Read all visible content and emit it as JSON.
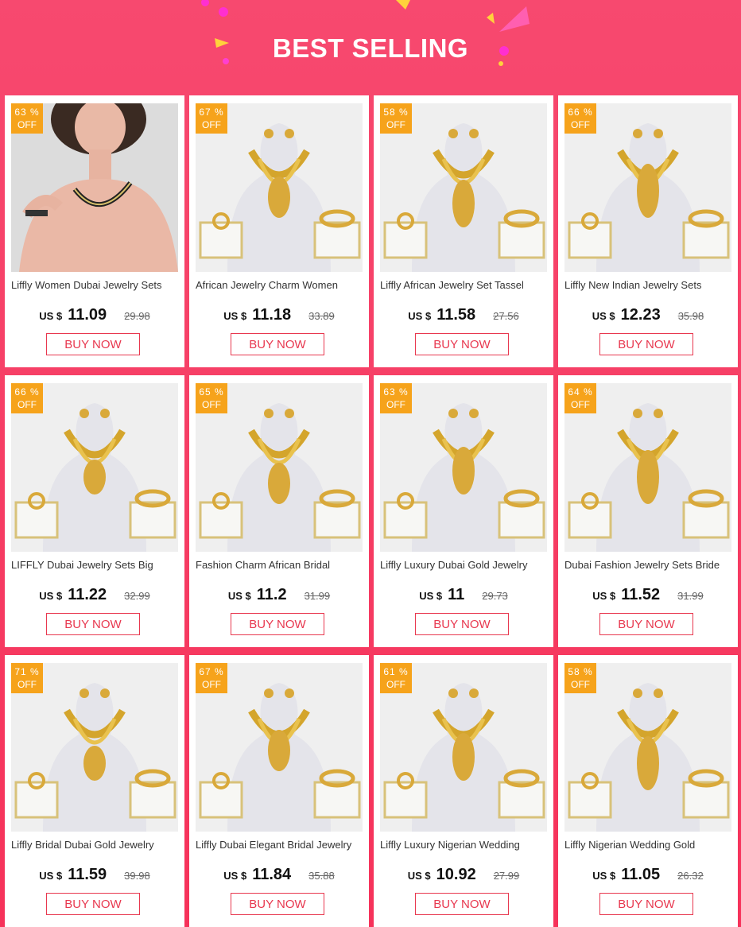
{
  "header": {
    "title": "BEST SELLING"
  },
  "labels": {
    "off": "OFF",
    "pct_sign": "%",
    "currency": "US $"
  },
  "colors": {
    "background": "#f6325a",
    "badge": "#f6a31b",
    "button_border": "#e8384f",
    "title_text": "#ffffff"
  },
  "products": [
    {
      "discount": "63",
      "title": "Liffly Women Dubai Jewelry Sets",
      "price": "11.09",
      "old_price": "29.98",
      "buy_label": "BUY NOW",
      "image": "model-wearing-necklace"
    },
    {
      "discount": "67",
      "title": "African Jewelry Charm Women",
      "price": "11.18",
      "old_price": "33.89",
      "buy_label": "BUY NOW",
      "image": "jewelry-set-on-bust"
    },
    {
      "discount": "58",
      "title": "Liffly African Jewelry Set Tassel",
      "price": "11.58",
      "old_price": "27.56",
      "buy_label": "BUY NOW",
      "image": "jewelry-set-on-bust"
    },
    {
      "discount": "66",
      "title": "Liffly New Indian Jewelry Sets",
      "price": "12.23",
      "old_price": "35.98",
      "buy_label": "BUY NOW",
      "image": "jewelry-set-on-bust"
    },
    {
      "discount": "66",
      "title": "LIFFLY Dubai Jewelry Sets Big",
      "price": "11.22",
      "old_price": "32.99",
      "buy_label": "BUY NOW",
      "image": "jewelry-set-on-bust"
    },
    {
      "discount": "65",
      "title": "Fashion Charm African Bridal",
      "price": "11.2",
      "old_price": "31.99",
      "buy_label": "BUY NOW",
      "image": "jewelry-set-on-bust"
    },
    {
      "discount": "63",
      "title": "Liffly Luxury Dubai Gold Jewelry",
      "price": "11",
      "old_price": "29.73",
      "buy_label": "BUY NOW",
      "image": "jewelry-set-on-bust"
    },
    {
      "discount": "64",
      "title": "Dubai Fashion Jewelry Sets  Bride",
      "price": "11.52",
      "old_price": "31.99",
      "buy_label": "BUY NOW",
      "image": "jewelry-set-on-bust"
    },
    {
      "discount": "71",
      "title": "Liffly Bridal Dubai Gold Jewelry",
      "price": "11.59",
      "old_price": "39.98",
      "buy_label": "BUY NOW",
      "image": "jewelry-set-on-bust"
    },
    {
      "discount": "67",
      "title": "Liffly Dubai Elegant Bridal Jewelry",
      "price": "11.84",
      "old_price": "35.88",
      "buy_label": "BUY NOW",
      "image": "jewelry-set-on-bust"
    },
    {
      "discount": "61",
      "title": "Liffly Luxury Nigerian Wedding",
      "price": "10.92",
      "old_price": "27.99",
      "buy_label": "BUY NOW",
      "image": "jewelry-set-on-bust"
    },
    {
      "discount": "58",
      "title": "Liffly Nigerian Wedding Gold",
      "price": "11.05",
      "old_price": "26.32",
      "buy_label": "BUY NOW",
      "image": "jewelry-set-on-bust"
    }
  ]
}
